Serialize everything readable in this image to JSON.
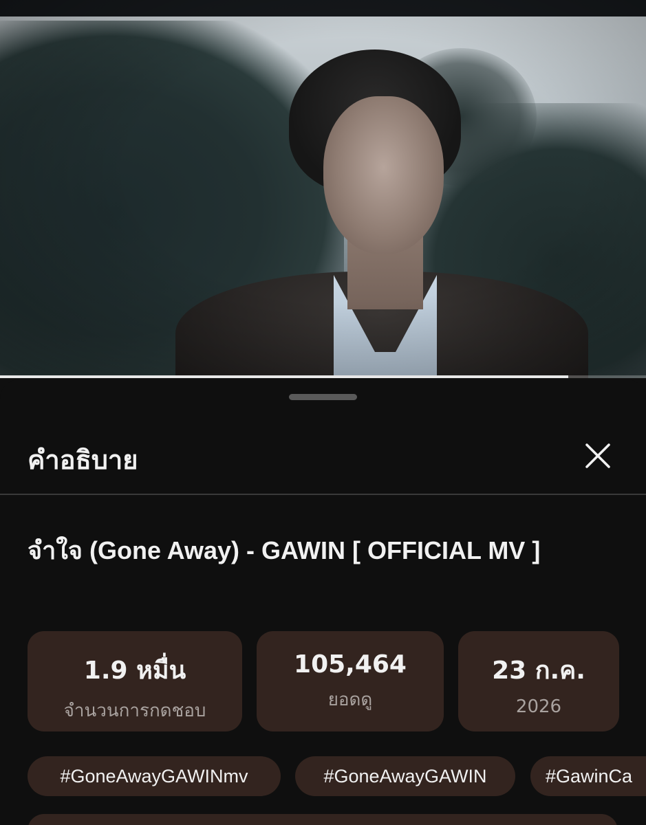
{
  "video": {
    "progress_fraction": 0.88
  },
  "sheet": {
    "title": "คำอธิบาย",
    "close_icon": "close-icon"
  },
  "details": {
    "video_title": "จำใจ (Gone Away) - GAWIN [ OFFICIAL MV ]",
    "stats": [
      {
        "value": "1.9 หมื่น",
        "label": "จำนวนการกดชอบ"
      },
      {
        "value": "105,464",
        "label": "ยอดดู"
      },
      {
        "value": "23 ก.ค.",
        "label": "2026"
      }
    ],
    "hashtags": [
      "#GoneAwayGAWINmv",
      "#GoneAwayGAWIN",
      "#GawinCa"
    ]
  },
  "colors": {
    "background": "#0f0f0f",
    "chip": "#33241f",
    "text": "#f1f1f1",
    "muted_text": "#a9a29f"
  }
}
